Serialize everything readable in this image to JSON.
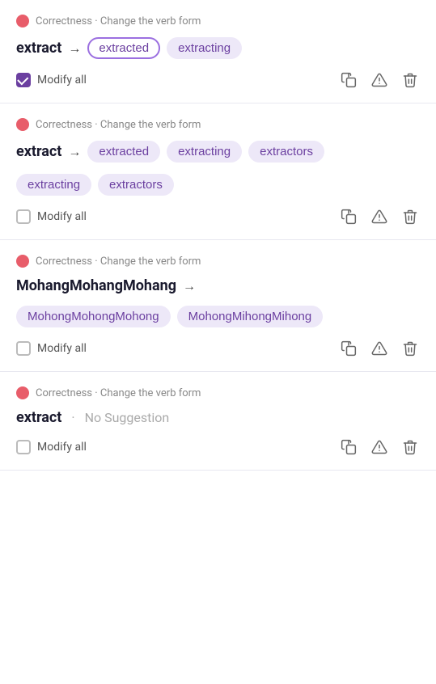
{
  "cards": [
    {
      "id": "card-1",
      "header": "Correctness · Change the verb form",
      "original": "extract",
      "suggestions": [
        {
          "label": "extracted",
          "selected": true
        },
        {
          "label": "extracting",
          "selected": false
        }
      ],
      "no_suggestion": false,
      "modify_all_checked": true,
      "modify_all_label": "Modify all"
    },
    {
      "id": "card-2",
      "header": "Correctness · Change the verb form",
      "original": "extract",
      "suggestions": [
        {
          "label": "extracted",
          "selected": false
        },
        {
          "label": "extracting",
          "selected": false
        },
        {
          "label": "extractors",
          "selected": false
        },
        {
          "label": "extracting",
          "selected": false
        },
        {
          "label": "extractors",
          "selected": false
        }
      ],
      "no_suggestion": false,
      "modify_all_checked": false,
      "modify_all_label": "Modify all"
    },
    {
      "id": "card-3",
      "header": "Correctness · Change the verb form",
      "original": "MohangMohangMohang",
      "suggestions": [
        {
          "label": "MohongMohongMohong",
          "selected": false
        },
        {
          "label": "MohongMihongMihong",
          "selected": false
        }
      ],
      "no_suggestion": false,
      "modify_all_checked": false,
      "modify_all_label": "Modify all"
    },
    {
      "id": "card-4",
      "header": "Correctness · Change the verb form",
      "original": "extract",
      "suggestions": [],
      "no_suggestion": true,
      "no_suggestion_text": "No Suggestion",
      "modify_all_checked": false,
      "modify_all_label": "Modify all"
    }
  ],
  "icons": {
    "copy": "copy-icon",
    "warning": "warning-icon",
    "trash": "trash-icon"
  }
}
